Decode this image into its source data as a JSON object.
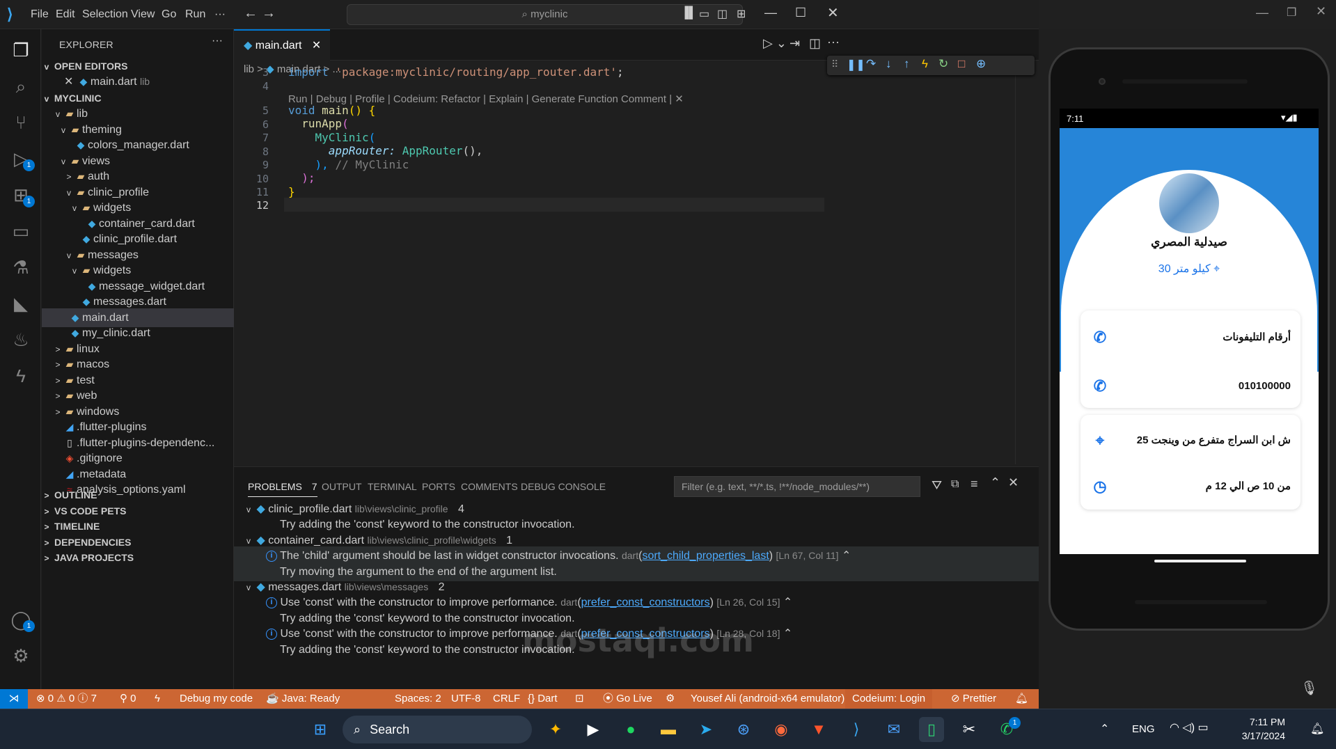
{
  "titlebar": {
    "menus": [
      "File",
      "Edit",
      "Selection",
      "View",
      "Go",
      "Run",
      "···"
    ],
    "search": "myclinic"
  },
  "activity_badges": {
    "run": "1",
    "extensions": "1",
    "account": "1"
  },
  "sidebar": {
    "title": "EXPLORER",
    "more": "···",
    "open_editors_label": "OPEN EDITORS",
    "open_editor": {
      "name": "main.dart",
      "path": "lib"
    },
    "project_label": "MYCLINIC",
    "tree": [
      {
        "name": "lib",
        "indent": 1,
        "chev": "v",
        "icon": "folder"
      },
      {
        "name": "theming",
        "indent": 2,
        "chev": "v",
        "icon": "folder"
      },
      {
        "name": "colors_manager.dart",
        "indent": 3,
        "chev": "",
        "icon": "dart"
      },
      {
        "name": "views",
        "indent": 2,
        "chev": "v",
        "icon": "folder"
      },
      {
        "name": "auth",
        "indent": 3,
        "chev": ">",
        "icon": "folder"
      },
      {
        "name": "clinic_profile",
        "indent": 3,
        "chev": "v",
        "icon": "folder"
      },
      {
        "name": "widgets",
        "indent": 4,
        "chev": "v",
        "icon": "folder"
      },
      {
        "name": "container_card.dart",
        "indent": 5,
        "chev": "",
        "icon": "dart"
      },
      {
        "name": "clinic_profile.dart",
        "indent": 4,
        "chev": "",
        "icon": "dart"
      },
      {
        "name": "messages",
        "indent": 3,
        "chev": "v",
        "icon": "folder"
      },
      {
        "name": "widgets",
        "indent": 4,
        "chev": "v",
        "icon": "folder"
      },
      {
        "name": "message_widget.dart",
        "indent": 5,
        "chev": "",
        "icon": "dart"
      },
      {
        "name": "messages.dart",
        "indent": 4,
        "chev": "",
        "icon": "dart"
      },
      {
        "name": "main.dart",
        "indent": 2,
        "chev": "",
        "icon": "dart",
        "selected": true
      },
      {
        "name": "my_clinic.dart",
        "indent": 2,
        "chev": "",
        "icon": "dart"
      },
      {
        "name": "linux",
        "indent": 1,
        "chev": ">",
        "icon": "folder"
      },
      {
        "name": "macos",
        "indent": 1,
        "chev": ">",
        "icon": "folder"
      },
      {
        "name": "test",
        "indent": 1,
        "chev": ">",
        "icon": "folder"
      },
      {
        "name": "web",
        "indent": 1,
        "chev": ">",
        "icon": "folder"
      },
      {
        "name": "windows",
        "indent": 1,
        "chev": ">",
        "icon": "folder"
      },
      {
        "name": ".flutter-plugins",
        "indent": 1,
        "chev": "",
        "icon": "flutter"
      },
      {
        "name": ".flutter-plugins-dependenc...",
        "indent": 1,
        "chev": "",
        "icon": "file"
      },
      {
        "name": ".gitignore",
        "indent": 1,
        "chev": "",
        "icon": "git"
      },
      {
        "name": ".metadata",
        "indent": 1,
        "chev": "",
        "icon": "flutter"
      },
      {
        "name": "analysis_options.yaml",
        "indent": 1,
        "chev": "",
        "icon": "yaml"
      }
    ],
    "bottom_sections": [
      "OUTLINE",
      "VS CODE PETS",
      "TIMELINE",
      "DEPENDENCIES",
      "JAVA PROJECTS"
    ]
  },
  "editor": {
    "tab_label": "main.dart",
    "breadcrumb": [
      "lib",
      "main.dart",
      "..."
    ],
    "codelens": "Run | Debug | Profile | Codeium: Refactor | Explain | Generate Function Comment | ✕",
    "line_numbers": [
      "3",
      "4",
      "5",
      "6",
      "7",
      "8",
      "9",
      "10",
      "11",
      "12"
    ],
    "code": {
      "l3_kw": "import",
      "l3_str": "'package:myclinic/routing/app_router.dart'",
      "l3_end": ";",
      "l5_kw": "void",
      "l5_fn": "main",
      "l5_rest": "() {",
      "l6_fn": "runApp",
      "l6_rest": "(",
      "l7_cls": "MyClinic",
      "l7_rest": "(",
      "l8_prm": "appRouter:",
      "l8_cls": "AppRouter",
      "l8_rest": "(),",
      "l9_rest": "),",
      "l9_cmt": "// MyClinic",
      "l10_rest": ");",
      "l11_rest": "}"
    }
  },
  "panel": {
    "tabs": [
      "PROBLEMS",
      "OUTPUT",
      "TERMINAL",
      "PORTS",
      "COMMENTS",
      "DEBUG CONSOLE"
    ],
    "problems_count": "7",
    "filter_placeholder": "Filter (e.g. text, **/*.ts, !**/node_modules/**)",
    "groups": [
      {
        "file": "clinic_profile.dart",
        "path": "lib\\views\\clinic_profile",
        "count": "4"
      },
      {
        "file": "container_card.dart",
        "path": "lib\\views\\clinic_profile\\widgets",
        "count": "1"
      },
      {
        "file": "messages.dart",
        "path": "lib\\views\\messages",
        "count": "2"
      }
    ],
    "msg_const_hint": "Try adding the 'const' keyword to the constructor invocation.",
    "msg_child": "The 'child' argument should be last in widget constructor invocations.",
    "msg_child_src": "dart",
    "msg_child_rule": "sort_child_properties_last",
    "msg_child_pos": "[Ln 67, Col 11]",
    "msg_child_hint": "Try moving the argument to the end of the argument list.",
    "msg_const": "Use 'const' with the constructor to improve performance.",
    "msg_const_src": "dart",
    "msg_const_rule": "prefer_const_constructors",
    "msg_const_pos1": "[Ln 26, Col 15]",
    "msg_const_pos2": "[Ln 28, Col 18]"
  },
  "statusbar": {
    "errors": "0",
    "warnings": "0",
    "infos": "7",
    "ports": "0",
    "debug": "Debug my code",
    "java": "Java: Ready",
    "spaces": "Spaces: 2",
    "encoding": "UTF-8",
    "eol": "CRLF",
    "lang": "Dart",
    "golive": "Go Live",
    "device": "Yousef Ali (android-x64 emulator)",
    "codeium": "Codeium: Login",
    "prettier": "Prettier"
  },
  "phone": {
    "time": "7:11",
    "name": "صيدلية المصري",
    "distance": "كيلو متر 30",
    "rows": [
      {
        "text": "أرقام التليفونات",
        "icon": "phone"
      },
      {
        "text": "010100000",
        "icon": "phone"
      },
      {
        "text": "ش ابن السراج متفرع من وينجت 25",
        "icon": "location"
      },
      {
        "text": "من 10 ص الي 12 م",
        "icon": "clock"
      }
    ]
  },
  "taskbar": {
    "search": "Search",
    "lang": "ENG",
    "time": "7:11 PM",
    "date": "3/17/2024",
    "whatsapp_badge": "1"
  },
  "watermark": "mostaql.com",
  "colors": {
    "accent": "#0078d4",
    "statusbar": "#cc6633",
    "app_blue": "#2685d8"
  }
}
